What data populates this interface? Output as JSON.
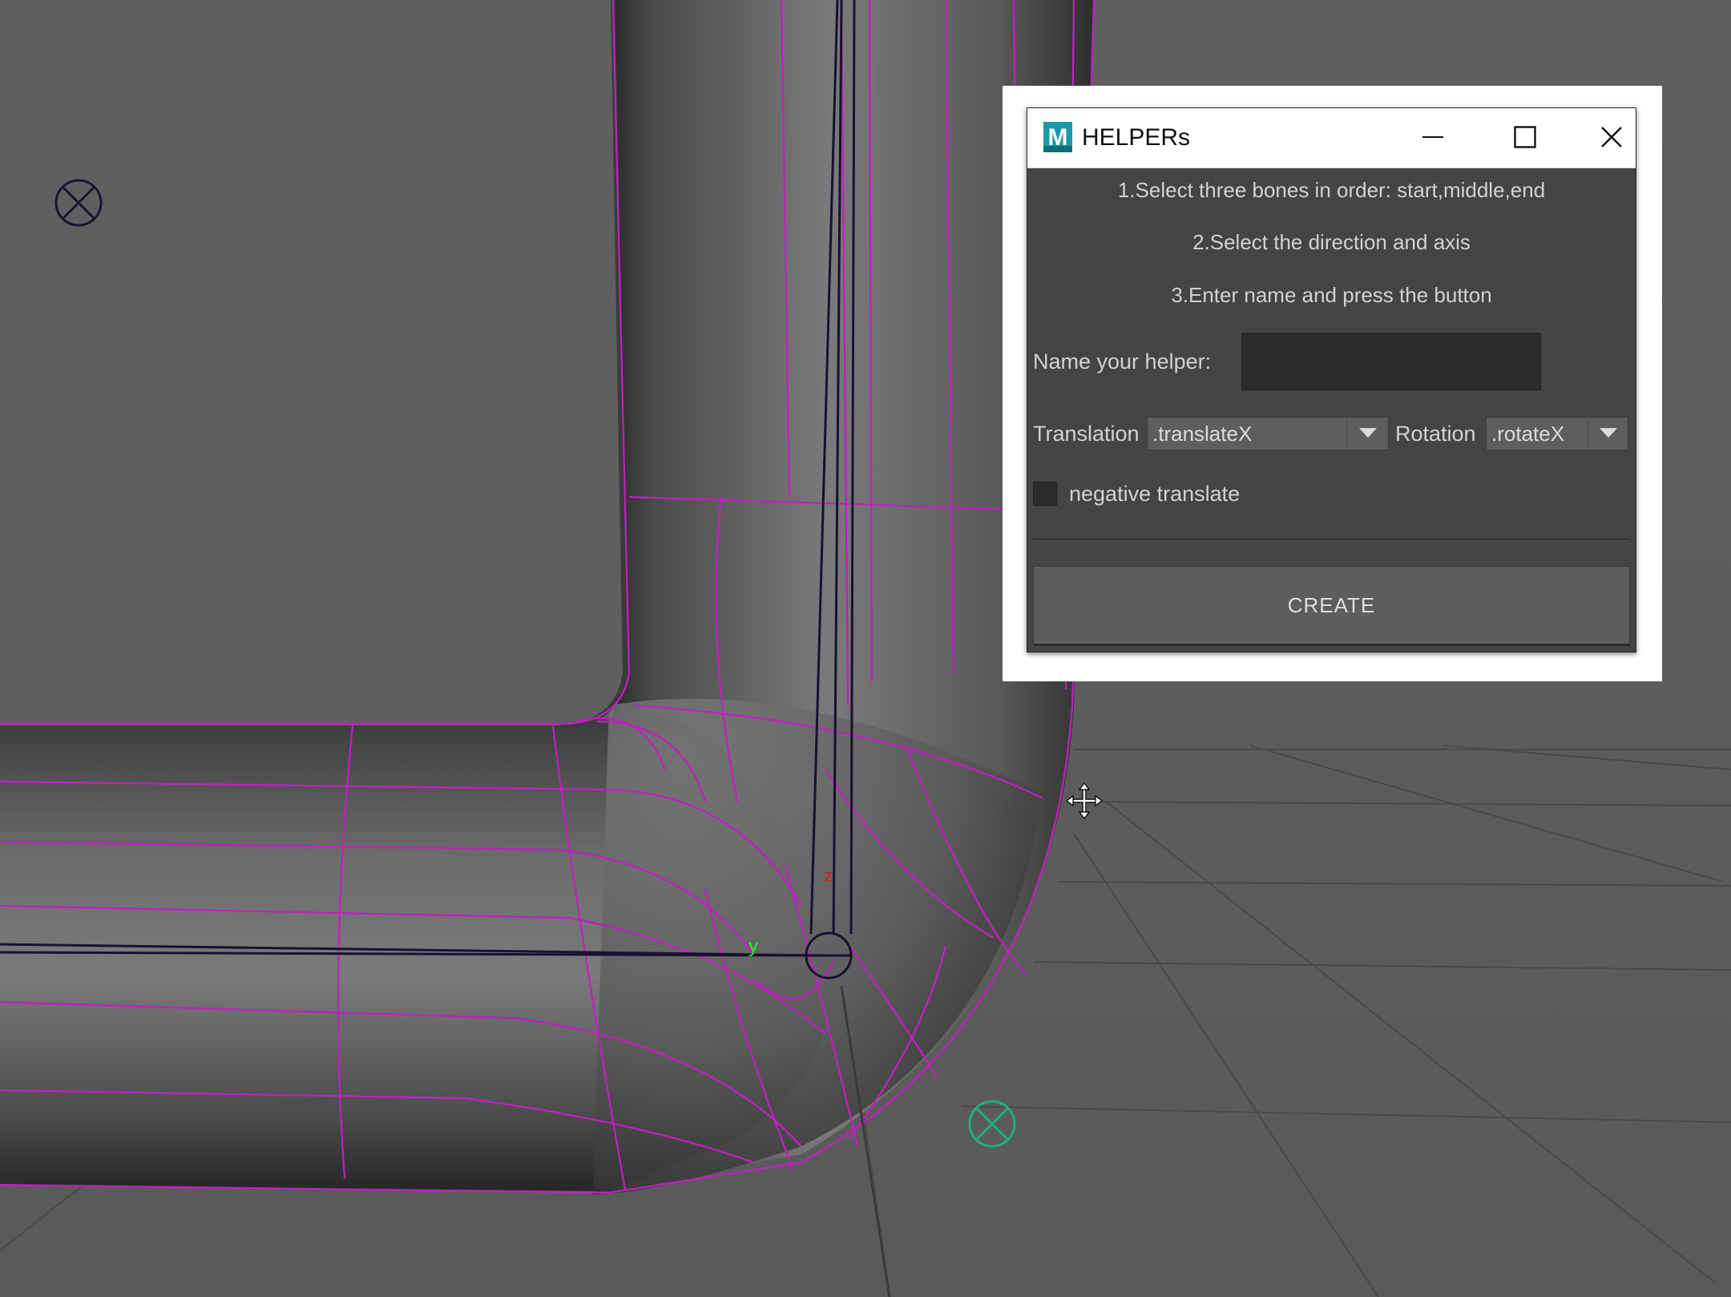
{
  "window": {
    "title": "HELPERs",
    "logo_letter": "M"
  },
  "instructions": [
    "1.Select three bones in order: start,middle,end",
    "2.Select the direction and axis",
    "3.Enter name and press the button"
  ],
  "form": {
    "name_label": "Name your helper:",
    "name_value": "",
    "translation_label": "Translation",
    "translation_value": ".translateX",
    "rotation_label": "Rotation",
    "rotation_value": ".rotateX",
    "negative_label": "negative translate",
    "negative_checked": false
  },
  "create_label": "CREATE",
  "viewport": {
    "axis_labels": {
      "z": "z",
      "y": "y"
    }
  },
  "colors": {
    "viewport_bg": "#5d5d5d",
    "wire": "#c21fc2",
    "dialog_bg": "#444444",
    "accent_logo": "#1a9aa8"
  }
}
